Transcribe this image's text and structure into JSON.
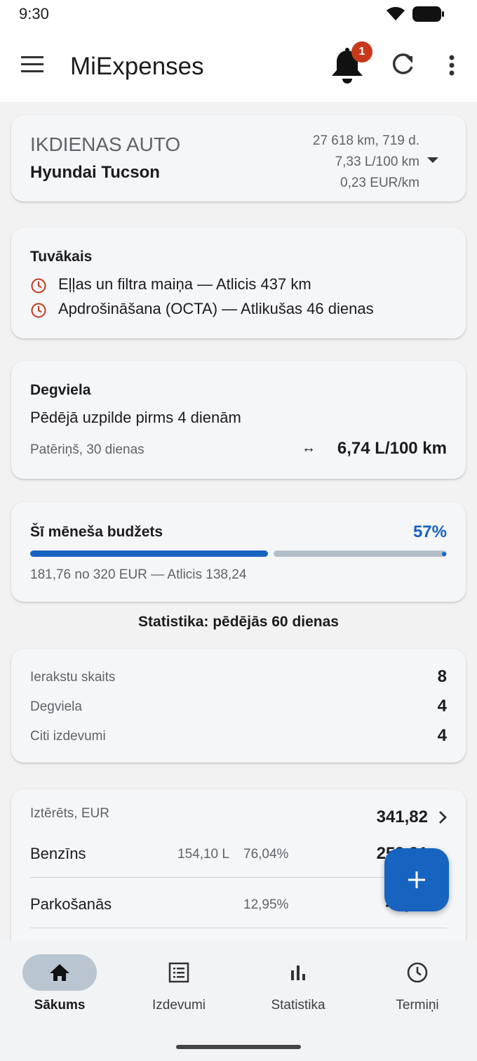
{
  "status_bar": {
    "time": "9:30"
  },
  "app_bar": {
    "title": "MiExpenses",
    "notification_count": "1"
  },
  "vehicle": {
    "label": "IKDIENAS AUTO",
    "name": "Hyundai Tucson",
    "distance_age": "27 618 km, 719 d.",
    "consumption": "7,33 L/100 km",
    "cost_per_km": "0,23 EUR/km"
  },
  "upcoming": {
    "title": "Tuvākais",
    "items": [
      {
        "text": "Eļļas un filtra maiņa — Atlicis 437 km",
        "icon": "clock-icon"
      },
      {
        "text": "Apdrošināšana (OCTA) — Atlikušas 46 dienas",
        "icon": "clock-icon"
      }
    ]
  },
  "fuel": {
    "title": "Degviela",
    "last_fill": "Pēdējā uzpilde pirms 4 dienām",
    "consumption_label": "Patēriņš, 30 dienas",
    "consumption_value": "6,74 L/100 km"
  },
  "budget": {
    "title": "Šī mēneša budžets",
    "percent_text": "57%",
    "progress": 0.57,
    "details": "181,76 no 320 EUR — Atlicis 138,24"
  },
  "statistics": {
    "heading": "Statistika: pēdējās 60 dienas",
    "rows": [
      {
        "label": "Ierakstu skaits",
        "value": "8"
      },
      {
        "label": "Degviela",
        "value": "4"
      },
      {
        "label": "Citi izdevumi",
        "value": "4"
      }
    ]
  },
  "spending": {
    "label": "Iztērēts, EUR",
    "total": "341,82",
    "rows": [
      {
        "name": "Benzīns",
        "quantity": "154,10 L",
        "percent": "76,04%",
        "amount": "259,91"
      },
      {
        "name": "Parkošanās",
        "quantity": "",
        "percent": "12,95%",
        "amount": "44,27"
      }
    ]
  },
  "bottom_nav": {
    "items": [
      {
        "label": "Sākums",
        "icon": "home-icon"
      },
      {
        "label": "Izdevumi",
        "icon": "list-icon"
      },
      {
        "label": "Statistika",
        "icon": "bar-chart-icon"
      },
      {
        "label": "Termiņi",
        "icon": "clock-icon"
      }
    ],
    "active": 0
  },
  "colors": {
    "accent": "#1763c0",
    "badge": "#c8381b",
    "reminder_icon": "#c0391b",
    "progress_rest": "#b4bfc8"
  }
}
